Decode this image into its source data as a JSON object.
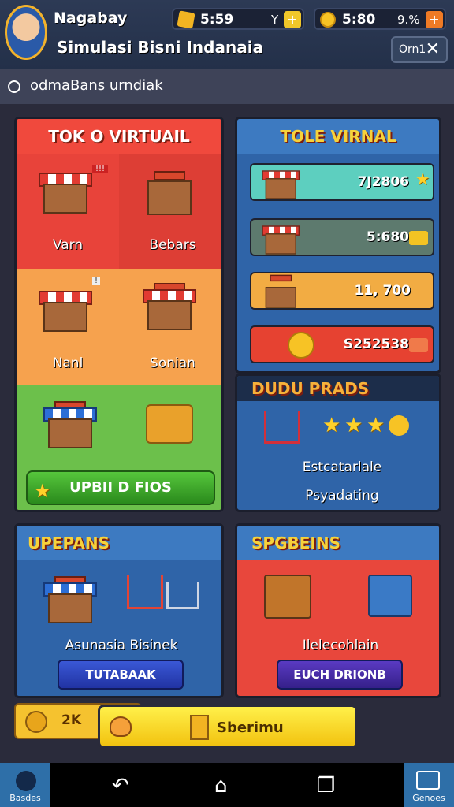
{
  "header": {
    "player_name": "Nagabay",
    "app_title": "Simulasi Bisni Indanaia",
    "resources": [
      {
        "icon": "gold-bar-icon",
        "value": "5:59",
        "suffix": "Y",
        "plus": "+",
        "plus_color": "#f1c72a"
      },
      {
        "icon": "coin-icon",
        "value": "5:80",
        "suffix": "9.%",
        "plus": "+",
        "plus_color": "#ef7a25"
      }
    ],
    "close_label": "Orn1"
  },
  "search": {
    "text": "odmaBans urndiak"
  },
  "toko_panel": {
    "title": "TOK O VIRTUAIL",
    "items": [
      {
        "label": "Varn",
        "badge": "!!!"
      },
      {
        "label": "Bebars",
        "badge": ""
      },
      {
        "label": "Nanl",
        "badge": "!"
      },
      {
        "label": "Sonian",
        "badge": ""
      }
    ],
    "upgrade_button": "UPBII D FIOS"
  },
  "tole_panel": {
    "title": "TOLE VIRNAL",
    "rows": [
      {
        "value": "7J2806",
        "color": "#5dcfbf"
      },
      {
        "value": "5:680",
        "color": "#5d7a6e"
      },
      {
        "value": "11, 700",
        "color": "#f2ac43"
      },
      {
        "value": "S252538",
        "color": "#e64231"
      }
    ]
  },
  "dudu_panel": {
    "title": "DUDU PRADS",
    "line1": "Estcatarlale",
    "line2": "Psyadating"
  },
  "upepans_panel": {
    "title": "UPEPANS",
    "caption": "Asunasia Bisinek",
    "button": "TUTABAAK"
  },
  "spgbeins_panel": {
    "title": "SPGBEINS",
    "caption": "Ilelecohlain",
    "button": "EUCH DRIONB"
  },
  "bottom_bar": {
    "coin_value": "2K",
    "main_button": "Sberimu"
  },
  "nav": {
    "left_label": "Basdes",
    "right_label": "Genoes"
  }
}
